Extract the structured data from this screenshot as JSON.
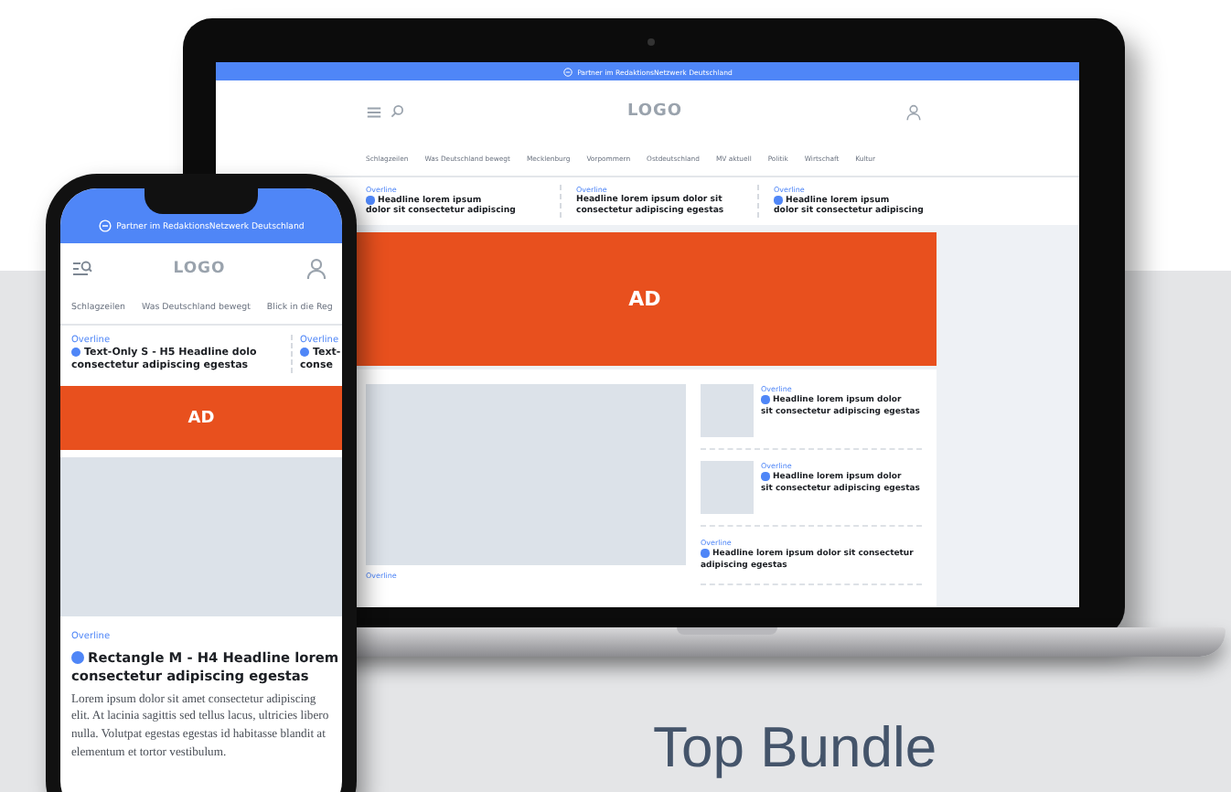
{
  "laptop": {
    "banner": "Partner im RedaktionsNetzwerk Deutschland",
    "logo": "LOGO",
    "nav": [
      "Schlagzeilen",
      "Was Deutschland bewegt",
      "Mecklenburg",
      "Vorpommern",
      "Ostdeutschland",
      "MV aktuell",
      "Politik",
      "Wirtschaft",
      "Kultur"
    ],
    "teasers": [
      {
        "overline": "Overline",
        "headline": "Headline lorem ipsum\ndolor sit consectetur adipiscing",
        "bullet": true
      },
      {
        "overline": "Overline",
        "headline": "Headline lorem ipsum dolor sit\nconsectetur adipiscing egestas",
        "bullet": false
      },
      {
        "overline": "Overline",
        "headline": "Headline lorem ipsum\ndolor sit consectetur adipiscing",
        "bullet": true
      }
    ],
    "ad": "AD",
    "lead": {
      "overline": "Overline"
    },
    "side_teasers": [
      {
        "kind": "thumb",
        "overline": "Overline",
        "headline": "Headline lorem ipsum dolor\nsit consectetur adipiscing egestas",
        "bullet": true
      },
      {
        "kind": "thumb",
        "overline": "Overline",
        "headline": "Headline lorem ipsum dolor\nsit consectetur adipiscing egestas",
        "bullet": true
      },
      {
        "kind": "text",
        "overline": "Overline",
        "headline": "Headline lorem ipsum dolor sit consectetur\nadipiscing egestas",
        "bullet": true
      }
    ]
  },
  "phone": {
    "banner": "Partner im RedaktionsNetzwerk Deutschland",
    "logo": "LOGO",
    "nav": [
      "Schlagzeilen",
      "Was Deutschland bewegt",
      "Blick in die Reg"
    ],
    "teasers": [
      {
        "overline": "Overline",
        "headline": "Text-Only S - H5 Headline dolo\nconsectetur adipiscing egestas",
        "bullet": true
      },
      {
        "overline": "Overline",
        "headline": "Text-\nconse",
        "bullet": true
      }
    ],
    "ad": "AD",
    "article": {
      "overline": "Overline",
      "headline": "Rectangle M - H4 Headline lorem\nconsectetur adipiscing egestas",
      "bullet": true,
      "body": "Lorem ipsum dolor sit amet consectetur adipiscing elit. At lacinia sagittis sed tellus lacus, ultricies libero nulla. Volutpat egestas egestas id habitasse blandit at elementum et tortor vestibulum."
    }
  },
  "caption": "Top Bundle"
}
